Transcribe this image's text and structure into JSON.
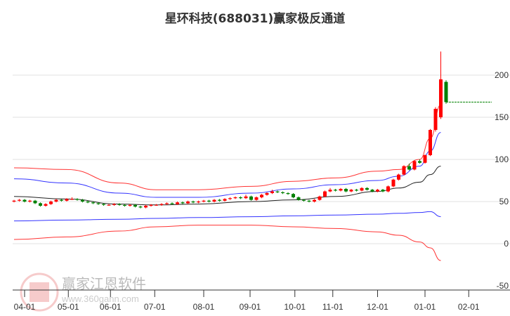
{
  "chart_data": {
    "type": "candlestick",
    "title": "星环科技(688031)赢家极反通道",
    "ylim": [
      -50,
      230
    ],
    "yticks": [
      200,
      150,
      100,
      50,
      0,
      -50
    ],
    "xticks": [
      {
        "label": "04-01",
        "i": 2
      },
      {
        "label": "05-01",
        "i": 10.3
      },
      {
        "label": "06-01",
        "i": 18.3
      },
      {
        "label": "07-01",
        "i": 26.7
      },
      {
        "label": "08-01",
        "i": 36
      },
      {
        "label": "09-01",
        "i": 44.8
      },
      {
        "label": "10-01",
        "i": 53.3
      },
      {
        "label": "11-01",
        "i": 60.5
      },
      {
        "label": "12-01",
        "i": 69
      },
      {
        "label": "01-01",
        "i": 78
      },
      {
        "label": "02-01",
        "i": 86.3
      }
    ],
    "candles": [
      [
        50,
        52,
        49,
        51
      ],
      [
        51,
        53,
        50,
        52
      ],
      [
        52,
        53,
        49,
        50
      ],
      [
        50,
        52,
        49,
        51
      ],
      [
        51,
        52,
        47,
        48
      ],
      [
        48,
        49,
        44,
        45
      ],
      [
        45,
        48,
        44,
        47
      ],
      [
        47,
        51,
        46,
        50
      ],
      [
        50,
        53,
        49,
        52
      ],
      [
        52,
        53,
        50,
        51
      ],
      [
        51,
        54,
        50,
        53
      ],
      [
        53,
        55,
        52,
        53
      ],
      [
        53,
        54,
        51,
        52
      ],
      [
        52,
        53,
        49,
        50
      ],
      [
        50,
        51,
        48,
        49
      ],
      [
        49,
        50,
        47,
        48
      ],
      [
        48,
        49,
        46,
        47
      ],
      [
        47,
        48,
        45,
        46
      ],
      [
        46,
        47,
        45,
        46
      ],
      [
        46,
        48,
        45,
        47
      ],
      [
        47,
        48,
        45,
        46
      ],
      [
        46,
        47,
        44,
        45
      ],
      [
        45,
        47,
        44,
        46
      ],
      [
        46,
        47,
        43,
        44
      ],
      [
        44,
        45,
        42,
        43
      ],
      [
        43,
        46,
        42,
        45
      ],
      [
        45,
        47,
        44,
        46
      ],
      [
        46,
        47,
        45,
        46
      ],
      [
        46,
        48,
        45,
        47
      ],
      [
        47,
        49,
        46,
        48
      ],
      [
        48,
        49,
        46,
        47
      ],
      [
        47,
        50,
        46,
        49
      ],
      [
        49,
        50,
        47,
        48
      ],
      [
        48,
        51,
        47,
        50
      ],
      [
        50,
        51,
        48,
        49
      ],
      [
        49,
        51,
        48,
        50
      ],
      [
        50,
        52,
        49,
        51
      ],
      [
        51,
        52,
        49,
        50
      ],
      [
        50,
        53,
        49,
        52
      ],
      [
        52,
        53,
        50,
        51
      ],
      [
        51,
        54,
        50,
        53
      ],
      [
        53,
        55,
        52,
        54
      ],
      [
        54,
        56,
        53,
        55
      ],
      [
        55,
        56,
        53,
        54
      ],
      [
        54,
        58,
        53,
        56
      ],
      [
        56,
        57,
        51,
        52
      ],
      [
        52,
        56,
        51,
        55
      ],
      [
        55,
        59,
        54,
        58
      ],
      [
        58,
        61,
        57,
        60
      ],
      [
        60,
        64,
        59,
        62
      ],
      [
        62,
        63,
        60,
        61
      ],
      [
        61,
        62,
        59,
        60
      ],
      [
        60,
        61,
        58,
        59
      ],
      [
        59,
        60,
        54,
        55
      ],
      [
        55,
        56,
        51,
        52
      ],
      [
        52,
        53,
        50,
        51
      ],
      [
        51,
        52,
        49,
        50
      ],
      [
        50,
        53,
        49,
        52
      ],
      [
        52,
        57,
        51,
        56
      ],
      [
        56,
        63,
        55,
        62
      ],
      [
        62,
        66,
        61,
        64
      ],
      [
        64,
        65,
        62,
        63
      ],
      [
        63,
        66,
        62,
        65
      ],
      [
        65,
        66,
        61,
        62
      ],
      [
        62,
        65,
        61,
        64
      ],
      [
        64,
        65,
        62,
        63
      ],
      [
        63,
        67,
        62,
        66
      ],
      [
        66,
        67,
        63,
        64
      ],
      [
        64,
        65,
        61,
        62
      ],
      [
        62,
        65,
        61,
        64
      ],
      [
        64,
        65,
        61,
        62
      ],
      [
        62,
        69,
        61,
        68
      ],
      [
        68,
        77,
        67,
        76
      ],
      [
        76,
        83,
        75,
        82
      ],
      [
        82,
        93,
        81,
        92
      ],
      [
        92,
        95,
        87,
        88
      ],
      [
        88,
        99,
        87,
        98
      ],
      [
        98,
        100,
        95,
        96
      ],
      [
        96,
        106,
        95,
        105
      ],
      [
        105,
        136,
        104,
        135
      ],
      [
        135,
        162,
        133,
        160
      ],
      [
        150,
        228,
        148,
        195
      ],
      [
        192,
        194,
        166,
        168
      ]
    ],
    "bands": {
      "idx": [
        0,
        10,
        20,
        27,
        35,
        45,
        53,
        61,
        69,
        73,
        77,
        79,
        81
      ],
      "upper_red": [
        90,
        88,
        72,
        64,
        64,
        68,
        74,
        78,
        86,
        88,
        100,
        125,
        165
      ],
      "upper_blue": [
        77,
        72,
        60,
        55,
        55,
        60,
        65,
        70,
        75,
        80,
        92,
        110,
        132
      ],
      "middle": [
        56,
        53,
        47,
        46,
        47,
        50,
        52,
        56,
        62,
        66,
        73,
        82,
        92
      ],
      "lower_blue": [
        27,
        28,
        29,
        30,
        31,
        32,
        33,
        34,
        35,
        36,
        37,
        38,
        32
      ],
      "lower_red": [
        5,
        8,
        15,
        20,
        22,
        22,
        20,
        18,
        14,
        10,
        2,
        -5,
        -20
      ]
    },
    "last_price_line": 168,
    "colors": {
      "up": "#ff0000",
      "down": "#008000",
      "upper_red": "#ff3333",
      "blue": "#3333ff",
      "middle": "#222222"
    }
  },
  "watermark": {
    "name": "赢家江恩软件",
    "url": "www.360gann.com",
    "seal": "江赢恩家"
  }
}
